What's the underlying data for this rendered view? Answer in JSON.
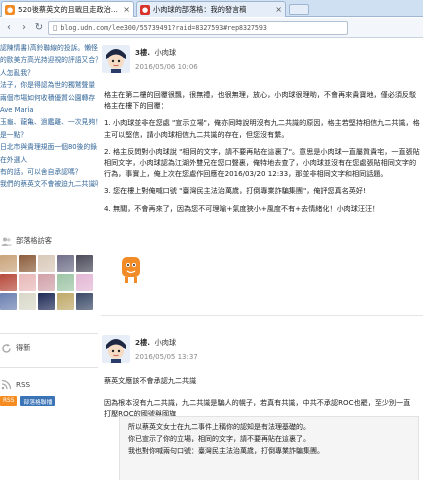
{
  "browser": {
    "tabs": [
      {
        "title": "520後蔡英文的且戰且走政治生態",
        "favicon": "tab-favicon-udn"
      },
      {
        "title": "小肉球的部落格：我的發言稿",
        "favicon": "tab-favicon-blog"
      }
    ],
    "url": "blog.udn.com/lee300/55739491?raid=8327593#rep8327593"
  },
  "sidebar": {
    "links": [
      "認陳情書)高鈴聯線的投訴。懶怪台",
      "的歐美方高光持迎視的評語又合？",
      "人怎亂我？",
      "法子，你是得認為世的獨鷲聲量",
      "兩個市場如何收積優質公園轉存",
      "Ave Maria",
      "玉龜、龍亀、過鑑離、一次見夠！",
      "是一點？",
      "日北市與貴理規面一個80後的錄目中國",
      "在外選人",
      "有的話，可以舍自承認嗎？",
      "我們的蔡英文不會被迫九二共識嗎"
    ],
    "visitors_title": "部落格訪客",
    "visitor_colors": [
      "#c9a37a",
      "#8c5d3b",
      "#d8c8b8",
      "#6e6e88",
      "#4a4a5a",
      "#b64a3b",
      "#e8b8b8",
      "#d0a0a8",
      "#9cc4a4",
      "#e3b6d4",
      "#6a7fb0",
      "#d8d7c8",
      "#202c58",
      "#bfa868",
      "#3b4a68"
    ],
    "recent_title": "得新",
    "rss_title": "RSS",
    "rss_buttons": [
      "RSS",
      "部落格聯播"
    ],
    "colors": {
      "rss_orange": "#f68b1f",
      "rss_blue": "#3a73b6"
    }
  },
  "post1": {
    "floor": "3樓.",
    "author": "小肉球",
    "date": "2016/05/06 10:06",
    "paragraphs": [
      "格主在第二樓的回覆很飄，很無禮，也很無理，放心，小肉球很理喲，不會再來貴寶地，僅必須反駁格主在樓下的回覆：",
      "1. 小肉球並非在您處 \"宣示立場\"，俺亦同時說明沒有九二共識的原因，格主若堅持相信九二共識，格主可以堅信，請小肉球相信九二共識的存在，但您沒有繫。",
      "2. 格主反問對小肉球說 \"相同的文字，請不要再貼在這裏了\"。意思是小肉球一直屬質貴宅，一直張貼相同文字，小肉球認為江湖外雙兄在您口聲裏，俺特地去查了，小肉球並沒有在您處張貼相同文字的行為，事實上，俺上次在您處作回應在2016/03/20 12:33，那並非相同文字和相同話題。",
      "3. 您在樓上對俺喊口號 \"臺灣民主法治萬歲，打倒專業詐騙集團\"，俺評您真名英好!",
      "4. 無關，不會再來了，因為您不可理喻+氣度狹小+風度不有+去情緒化！小肉球汪汪！"
    ]
  },
  "post2": {
    "floor": "2樓.",
    "author": "小肉球",
    "date": "2016/05/05 13:37",
    "paragraphs": [
      "蔡英文應該不會承認九二共識",
      "因為根本沒有九二共識，九二共識是騙人的幌子，若真有共識，中共不承認ROC也罷，至少別一直打壓ROC的國號與國旗"
    ],
    "quote_lines": [
      "所以蔡英文女士在九二事件上稱你的認知是有法理基礎的。",
      "你已宣示了你的立場，相同的文字，請不要再貼在這裏了。",
      "我也對你喊兩句口號：臺灣民主法治萬歲，打倒專業詐騙集團。"
    ]
  }
}
